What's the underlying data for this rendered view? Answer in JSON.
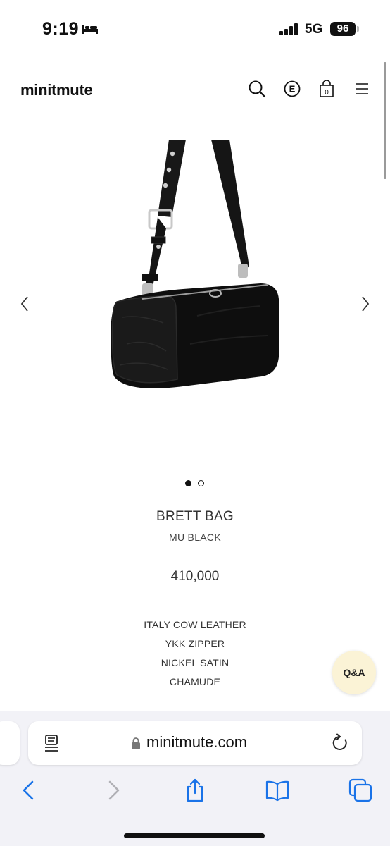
{
  "status_bar": {
    "time": "9:19",
    "network": "5G",
    "battery": "96",
    "icons": [
      "sleep-focus-icon",
      "signal-icon",
      "battery-icon"
    ]
  },
  "header": {
    "logo": "minitmute",
    "icons": [
      "search-icon",
      "currency-e-icon",
      "cart-icon",
      "menu-icon"
    ],
    "cart_count": "0",
    "currency_letter": "E"
  },
  "gallery": {
    "image": "black-leather-brett-bag-image",
    "slide_index": 1,
    "slide_count": 2
  },
  "product": {
    "name": "BRETT BAG",
    "color": "MU BLACK",
    "price": "410,000",
    "features": [
      "ITALY COW LEATHER",
      "YKK ZIPPER",
      "NICKEL SATIN",
      "CHAMUDE"
    ]
  },
  "qa_button": {
    "label": "Q&A",
    "color": "#fbf3d6"
  },
  "browser": {
    "url": "minitmute.com",
    "accent_color": "#1a73e8",
    "toolbar_icons": [
      "back-icon",
      "forward-icon",
      "share-icon",
      "bookmarks-icon",
      "tabs-icon"
    ]
  }
}
